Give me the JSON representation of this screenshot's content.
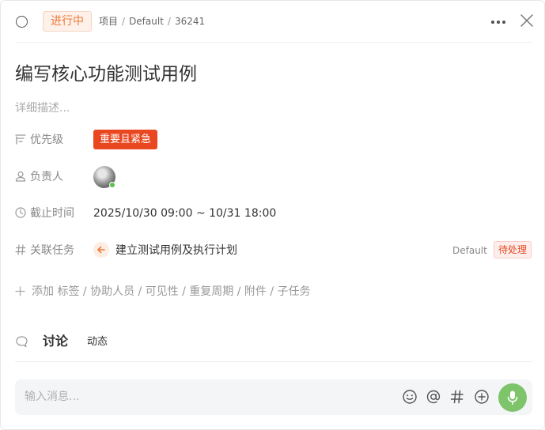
{
  "header": {
    "status_label": "进行中",
    "breadcrumb": [
      "项目",
      "Default",
      "36241"
    ]
  },
  "task": {
    "title": "编写核心功能测试用例",
    "description_placeholder": "详细描述..."
  },
  "fields": {
    "priority": {
      "label": "优先级",
      "value": "重要且紧急"
    },
    "assignee": {
      "label": "负责人"
    },
    "due": {
      "label": "截止时间",
      "value": "2025/10/30 09:00 ~ 10/31 18:00"
    },
    "related": {
      "label": "关联任务",
      "name": "建立测试用例及执行计划",
      "project": "Default",
      "status": "待处理"
    }
  },
  "add_more": {
    "label": "添加 标签 / 协助人员 / 可见性 / 重复周期 / 附件 / 子任务"
  },
  "tabs": {
    "discuss": "讨论",
    "activity": "动态"
  },
  "composer": {
    "placeholder": "输入消息..."
  },
  "colors": {
    "accent_orange": "#f07a3a",
    "priority_red": "#e8471f",
    "mic_green": "#7dc46a",
    "online_green": "#5bc24a"
  },
  "icons": {
    "status": "status-circle-icon",
    "more": "more-horizontal-icon",
    "close": "close-icon",
    "priority": "priority-sort-icon",
    "assignee": "user-icon",
    "due": "clock-icon",
    "related": "hash-icon",
    "related_task": "arrow-left-icon",
    "add": "plus-icon",
    "discussion": "chat-bubble-icon",
    "emoji": "smile-icon",
    "mention": "at-icon",
    "topic": "hash-icon",
    "more_actions": "plus-circle-icon",
    "mic": "microphone-icon"
  }
}
